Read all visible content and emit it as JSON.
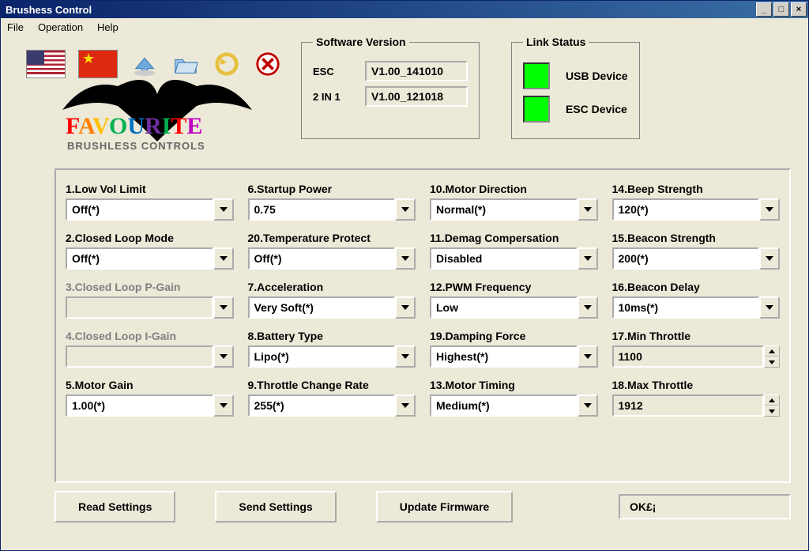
{
  "window": {
    "title": "Brushess Control"
  },
  "menu": [
    "File",
    "Operation",
    "Help"
  ],
  "software": {
    "legend": "Software Version",
    "esc_label": "ESC",
    "esc_value": "V1.00_141010",
    "twoin1_label": "2 IN 1",
    "twoin1_value": "V1.00_121018"
  },
  "link": {
    "legend": "Link Status",
    "usb": "USB Device",
    "esc": "ESC Device",
    "usb_color": "#00FF00",
    "esc_color": "#00FF00"
  },
  "params": {
    "c1": [
      {
        "label": "1.Low Vol Limit",
        "value": "Off(*)"
      },
      {
        "label": "2.Closed Loop Mode",
        "value": "Off(*)"
      },
      {
        "label": "3.Closed Loop P-Gain",
        "value": "",
        "disabled": true
      },
      {
        "label": "4.Closed Loop I-Gain",
        "value": "",
        "disabled": true
      },
      {
        "label": "5.Motor Gain",
        "value": "1.00(*)"
      }
    ],
    "c2": [
      {
        "label": "6.Startup Power",
        "value": "0.75"
      },
      {
        "label": "20.Temperature Protect",
        "value": "Off(*)"
      },
      {
        "label": "7.Acceleration",
        "value": "Very Soft(*)"
      },
      {
        "label": "8.Battery Type",
        "value": "Lipo(*)"
      },
      {
        "label": "9.Throttle Change Rate",
        "value": "255(*)"
      }
    ],
    "c3": [
      {
        "label": "10.Motor Direction",
        "value": "Normal(*)"
      },
      {
        "label": "11.Demag Compersation",
        "value": "Disabled"
      },
      {
        "label": "12.PWM Frequency",
        "value": "Low"
      },
      {
        "label": "19.Damping Force",
        "value": "Highest(*)"
      },
      {
        "label": "13.Motor Timing",
        "value": "Medium(*)"
      }
    ],
    "c4": [
      {
        "label": "14.Beep Strength",
        "value": "120(*)"
      },
      {
        "label": "15.Beacon Strength",
        "value": "200(*)"
      },
      {
        "label": "16.Beacon Delay",
        "value": "10ms(*)"
      },
      {
        "label": "17.Min Throttle",
        "value": "1100",
        "type": "spin"
      },
      {
        "label": "18.Max Throttle",
        "value": "1912",
        "type": "spin"
      }
    ]
  },
  "buttons": {
    "read": "Read Settings",
    "send": "Send Settings",
    "update": "Update Firmware"
  },
  "status": "OK£¡"
}
